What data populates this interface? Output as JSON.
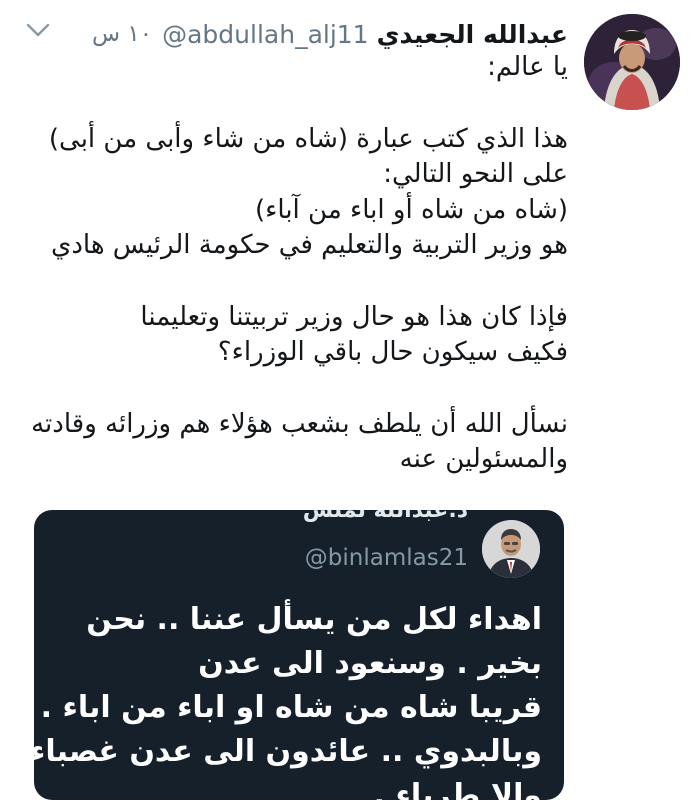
{
  "tweet": {
    "display_name": "عبدالله الجعيدي",
    "handle": "@abdullah_alj11",
    "timestamp": "١٠ س",
    "lines": [
      "يا عالم:",
      "",
      "هذا الذي كتب عبارة (شاه من شاء وأبى من أبى)",
      "على النحو التالي:",
      "(شاه من شاه أو اباء من آباء)",
      "هو وزير التربية والتعليم في حكومة الرئيس هادي",
      "",
      "فإذا كان هذا هو حال وزير تربيتنا وتعليمنا",
      "فكيف سيكون حال باقي الوزراء؟",
      "",
      "نسأل الله أن يلطف بشعب هؤلاء هم وزرائه وقادته",
      "والمسئولين عنه"
    ]
  },
  "quote": {
    "name_partial": "د.عبدالله لملس",
    "handle": "@binlamlas21",
    "lines": [
      "اهداء لكل من يسأل عننا .. نحن",
      "بخير .       وسنعود الى عدن",
      "قريبا شاه من شاه او اباء من اباء .",
      "وبالبدوي .. عائدون الى عدن غصباء",
      "والا طرباء ."
    ]
  },
  "colors": {
    "text": "#14171a",
    "muted": "#657786",
    "quote_bg": "#15202b"
  },
  "icons": [
    "chevron-down-icon",
    "avatar",
    "quoted-avatar"
  ]
}
